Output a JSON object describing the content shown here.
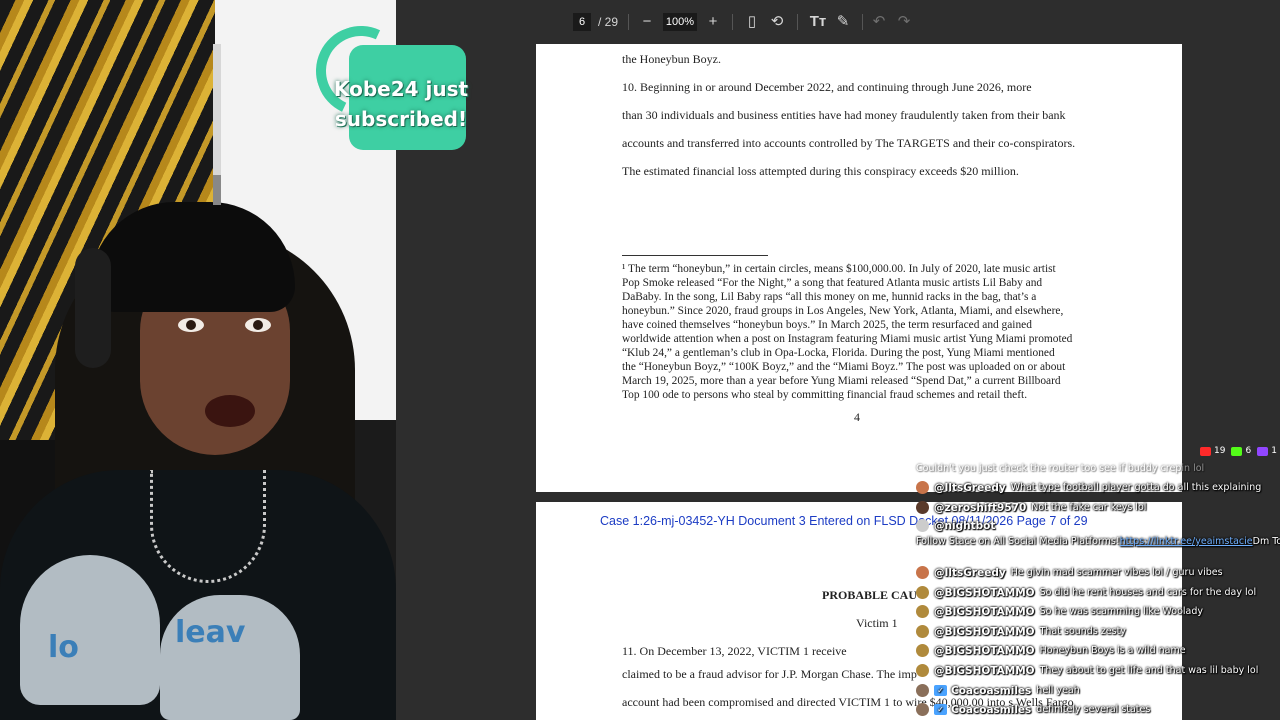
{
  "toolbar": {
    "current_page": "6",
    "total_pages": "/ 29",
    "zoom": "100%",
    "icons": [
      "zoom-out-icon",
      "zoom-in-icon",
      "fit-page-icon",
      "rotate-icon",
      "text-size-icon",
      "draw-icon",
      "undo-icon",
      "redo-icon"
    ]
  },
  "alert": {
    "line1": "Kobe24 just",
    "line2": "subscribed!",
    "brand_color": "#3ecfa3"
  },
  "page6": {
    "top_line": "the Honeybun Boyz.",
    "para10": [
      "10.      Beginning in or around December 2022, and continuing through June 2026, more",
      "than 30 individuals and business entities have had money fraudulently taken from their bank",
      "accounts and transferred into accounts controlled by The TARGETS and their co-conspirators.",
      "The estimated financial loss attempted during this conspiracy exceeds $20 million."
    ],
    "footnote": [
      "¹ The term “honeybun,” in certain circles, means $100,000.00. In July of 2020, late music artist",
      "Pop Smoke released “For the Night,” a song that featured Atlanta music artists Lil Baby and",
      "DaBaby. In the song, Lil Baby raps “all this money on me, hunnid racks in the bag, that’s a",
      "honeybun.” Since 2020, fraud groups in Los Angeles, New York, Atlanta, Miami, and elsewhere,",
      "have coined themselves “honeybun boys.” In March 2025, the term resurfaced and gained",
      "worldwide attention when a post on Instagram featuring Miami music artist Yung Miami promoted",
      "“Klub 24,” a gentleman’s club in Opa-Locka, Florida. During the post, Yung Miami mentioned",
      "the “Honeybun Boyz,” “100K Boyz,” and the “Miami Boyz.” The post was uploaded on or about",
      "March 19, 2025, more than a year before Yung Miami released “Spend Dat,” a current Billboard",
      "Top 100 ode to persons who steal by committing financial fraud schemes and retail theft."
    ],
    "page_number": "4"
  },
  "page7": {
    "case_header": "Case 1:26-mj-03452-YH   Document 3   Entered on FLSD Docket 08/11/2026   Page 7 of 29",
    "section_title": "PROBABLE CAU",
    "subsection": "Victim 1",
    "lines": [
      "11.      On December 13, 2022, VICTIM 1 receive",
      "claimed to be a fraud advisor for J.P. Morgan Chase. The imp",
      "account had been compromised and directed VICTIM 1 to wire $40,000.00 into s Wells Fargo"
    ]
  },
  "chat": {
    "counts": [
      {
        "platform": "youtube-icon",
        "count": "19",
        "color": "#ff2a2a"
      },
      {
        "platform": "kick-icon",
        "count": "6",
        "color": "#53fc18"
      },
      {
        "platform": "twitch-icon",
        "count": "1",
        "color": "#9146ff"
      }
    ],
    "messages": [
      {
        "user": "",
        "text": "Couldn't you just check the router too see if buddy crepin lol",
        "faded": true,
        "avatar": "#777"
      },
      {
        "user": "@IltsGreedy",
        "text": "What type football player gotta do all this explaining",
        "faded": false,
        "avatar": "#c8744a"
      },
      {
        "user": "@zeroshift9570",
        "text": "Not the fake car keys lol",
        "faded": false,
        "avatar": "#5a3a2a"
      },
      {
        "user": "@nightbot",
        "text": "",
        "faded": false,
        "avatar": "#cccccc"
      },
      {
        "user": "",
        "text": "Follow Stace on All Social Media Platforms! ",
        "link": "https://linktr.ee/yeaimstacie",
        "tail": " Dm Topic Requests",
        "faded": false
      },
      {
        "user": "@IltsGreedy",
        "text": "He givin mad scammer vibes lol / guru vibes",
        "faded": false,
        "avatar": "#c8744a"
      },
      {
        "user": "@BIGSHOTAMMO",
        "text": "So did he rent houses and cars for the day lol",
        "faded": false,
        "avatar": "#b08a3c"
      },
      {
        "user": "@BIGSHOTAMMO",
        "text": "So he was scamming like Woolady",
        "faded": false,
        "avatar": "#b08a3c"
      },
      {
        "user": "@BIGSHOTAMMO",
        "text": "That sounds zesty",
        "faded": false,
        "avatar": "#b08a3c"
      },
      {
        "user": "@BIGSHOTAMMO",
        "text": "Honeybun Boys is a wild name",
        "faded": false,
        "avatar": "#b08a3c"
      },
      {
        "user": "@BIGSHOTAMMO",
        "text": "They about to get life and that was lil baby lol",
        "faded": false,
        "avatar": "#b08a3c"
      },
      {
        "user": "Coacoasmiles",
        "text": "hell yeah",
        "faded": false,
        "avatar": "#8a6f5a",
        "badge": true
      },
      {
        "user": "Coacoasmiles",
        "text": "definitely several states",
        "faded": false,
        "avatar": "#8a6f5a",
        "badge": true
      }
    ]
  }
}
